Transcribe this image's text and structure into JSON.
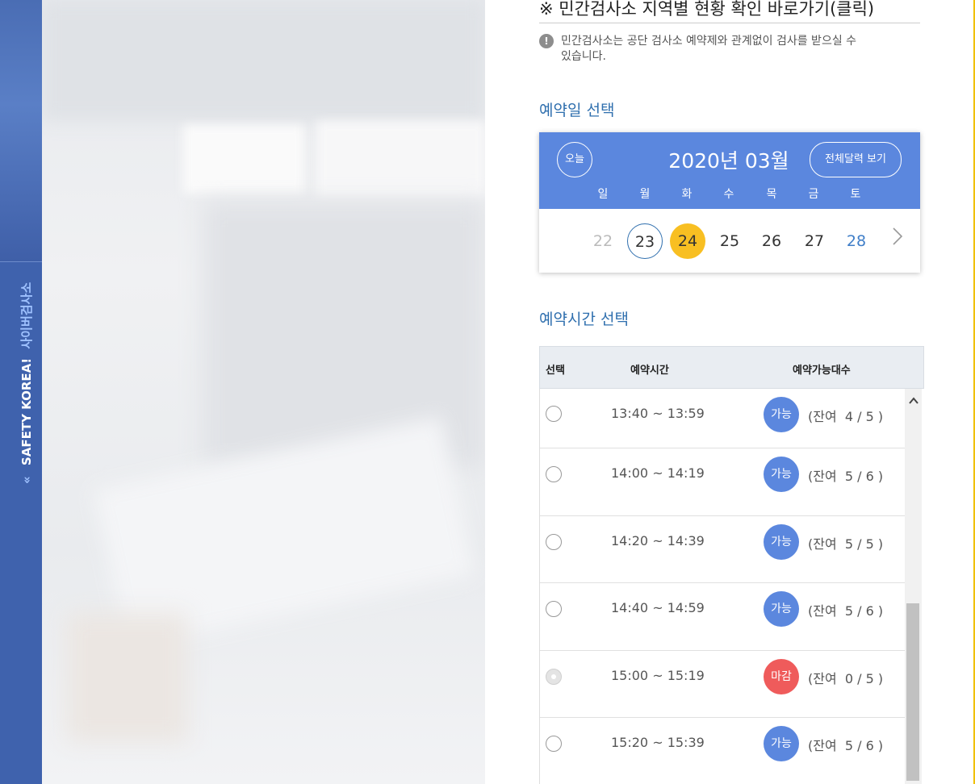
{
  "sidebar": {
    "chevron": "«",
    "tagline": "SAFETY KOREA!",
    "brand": "사이버검사소"
  },
  "private_centers": {
    "link_title": "※ 민간검사소 지역별 현황 확인 바로가기(클릭)",
    "notice_icon": "!",
    "notice_line1": "민간검사소는 공단 검사소 예약제와 관계없이 검사를 받으실 수",
    "notice_line2": "있습니다."
  },
  "date_section": {
    "title": "예약일 선택",
    "today_button": "오늘",
    "month_label": "2020년 03월",
    "full_calendar_button": "전체달력 보기",
    "weekdays": [
      "일",
      "월",
      "화",
      "수",
      "목",
      "금",
      "토"
    ],
    "days": [
      {
        "label": "22",
        "state": "past"
      },
      {
        "label": "23",
        "state": "today"
      },
      {
        "label": "24",
        "state": "selected"
      },
      {
        "label": "25",
        "state": "normal"
      },
      {
        "label": "26",
        "state": "normal"
      },
      {
        "label": "27",
        "state": "normal"
      },
      {
        "label": "28",
        "state": "saturday"
      }
    ],
    "next_icon": "chevron-right-icon"
  },
  "time_section": {
    "title": "예약시간 선택",
    "columns": {
      "select": "선택",
      "time": "예약시간",
      "availability": "예약가능대수"
    },
    "rows": [
      {
        "time": "13:40 ~ 13:59",
        "status": "가능",
        "remaining": "(잔여  4 / 5 )",
        "disabled": false
      },
      {
        "time": "14:00 ~ 14:19",
        "status": "가능",
        "remaining": "(잔여  5 / 6 )",
        "disabled": false
      },
      {
        "time": "14:20 ~ 14:39",
        "status": "가능",
        "remaining": "(잔여  5 / 5 )",
        "disabled": false
      },
      {
        "time": "14:40 ~ 14:59",
        "status": "가능",
        "remaining": "(잔여  5 / 6 )",
        "disabled": false
      },
      {
        "time": "15:00 ~ 15:19",
        "status": "마감",
        "remaining": "(잔여  0 / 5 )",
        "disabled": true
      },
      {
        "time": "15:20 ~ 15:39",
        "status": "가능",
        "remaining": "(잔여  5 / 6 )",
        "disabled": false
      }
    ]
  },
  "colors": {
    "calendar_header": "#5b87de",
    "section_title": "#2f6fae",
    "selected_day": "#f8bf22",
    "available_badge": "#5b87de",
    "closed_badge": "#ef5b5b",
    "sidebar": "#3f62ad"
  }
}
